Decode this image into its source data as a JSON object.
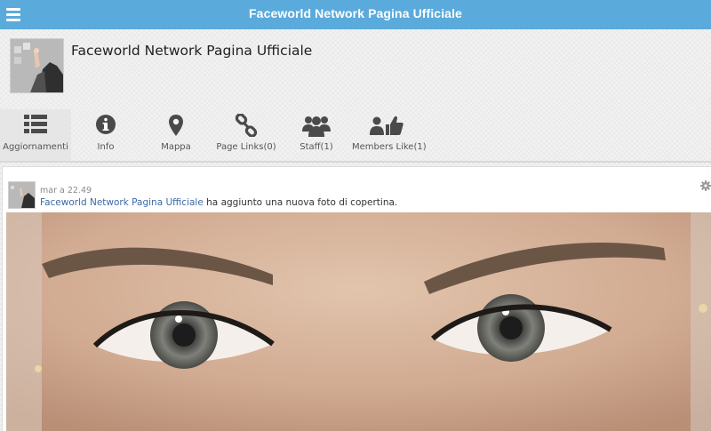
{
  "topbar": {
    "title": "Faceworld Network Pagina Ufficiale",
    "menu_icon": "hamburger-menu-icon"
  },
  "profile": {
    "name": "Faceworld Network Pagina Ufficiale"
  },
  "tabs": [
    {
      "label": "Aggiornamenti",
      "icon": "list-icon",
      "active": true
    },
    {
      "label": "Info",
      "icon": "info-icon"
    },
    {
      "label": "Mappa",
      "icon": "map-marker-icon"
    },
    {
      "label": "Page Links(0)",
      "icon": "link-icon"
    },
    {
      "label": "Staff(1)",
      "icon": "group-icon"
    },
    {
      "label": "Members Like(1)",
      "icon": "members-like-icon"
    }
  ],
  "post": {
    "time": "mar a 22.49",
    "author": "Faceworld Network Pagina Ufficiale",
    "action": " ha aggiunto una nuova foto di copertina."
  },
  "colors": {
    "topbar": "#5aaadc",
    "icon": "#4a4a4a",
    "link": "#3b6aa6",
    "active_tab": "#e6e6e6"
  }
}
